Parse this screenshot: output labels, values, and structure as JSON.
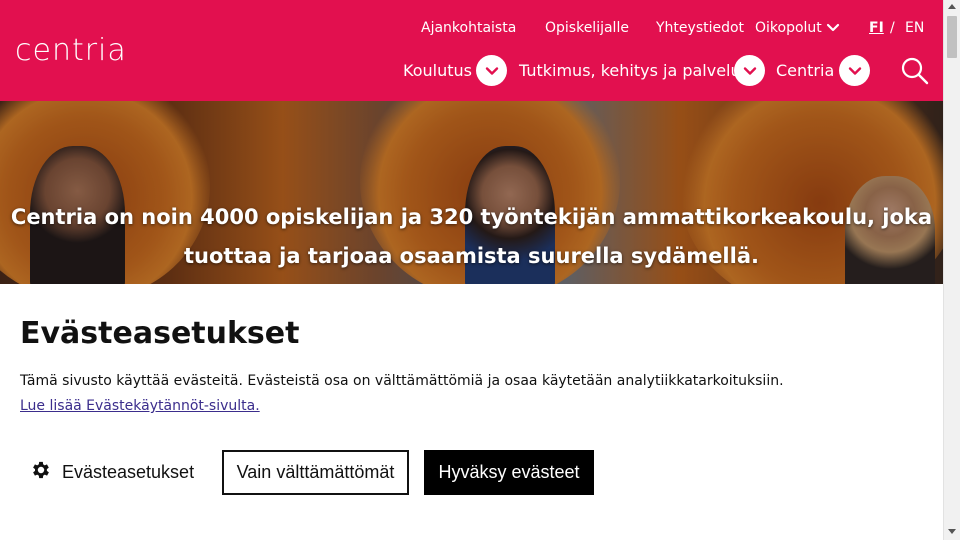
{
  "header": {
    "logo": "centria",
    "brand_color": "#e2104f",
    "top_links": [
      "Ajankohtaista",
      "Opiskelijalle",
      "Yhteystiedot",
      "Oikopolut"
    ],
    "lang_fi": "FI",
    "lang_sep": "/",
    "lang_en": "EN",
    "main_nav": [
      "Koulutus",
      "Tutkimus, kehitys ja palvelut",
      "Centria"
    ],
    "icons": {
      "dropdown": "chevron-down-icon",
      "search": "search-icon"
    }
  },
  "hero": {
    "text_line1": "Centria on noin 4000 opiskelijan ja 320 työntekijän ammattikorkeakoulu, joka",
    "text_line2": "tuottaa ja tarjoaa osaamista suurella sydämellä."
  },
  "cookies": {
    "title": "Evästeasetukset",
    "description": "Tämä sivusto käyttää evästeitä. Evästeistä osa on välttämättömiä ja osaa käytetään analytiikkatarkoituksiin.",
    "link": "Lue lisää Evästekäytännöt-sivulta.",
    "settings_button": "Evästeasetukset",
    "necessary_button": "Vain välttämättömät",
    "accept_button": "Hyväksy evästeet",
    "settings_icon": "gear-icon"
  }
}
